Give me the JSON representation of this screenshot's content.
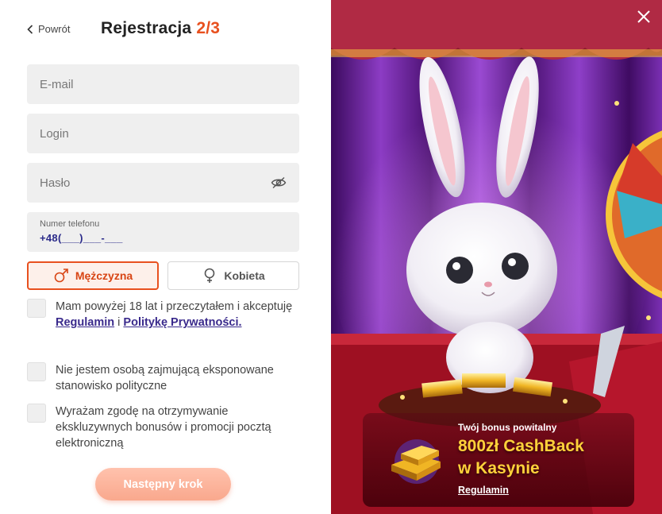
{
  "header": {
    "back_label": "Powrót",
    "title": "Rejestracja",
    "step": "2/3"
  },
  "form": {
    "email_placeholder": "E-mail",
    "login_placeholder": "Login",
    "password_placeholder": "Hasło",
    "phone_label": "Numer telefonu",
    "phone_value": "+48(___)___-___"
  },
  "gender": {
    "male_label": "Mężczyzna",
    "female_label": "Kobieta",
    "selected": "male"
  },
  "consents": {
    "age_text_1": "Mam powyżej 18 lat i przeczytałem i akceptuję",
    "age_link_terms": "Regulamin",
    "age_text_and": "i",
    "age_link_privacy": "Politykę Prywatności.",
    "political_text": "Nie jestem osobą zajmującą eksponowane stanowisko polityczne",
    "marketing_text": "Wyrażam zgodę na otrzymywanie ekskluzywnych bonusów i promocji pocztą elektroniczną"
  },
  "next_label": "Następny krok",
  "promo": {
    "subtitle": "Twój bonus powitalny",
    "title_line1": "800zł CashBack",
    "title_line2": "w Kasynie",
    "link": "Regulamin"
  },
  "colors": {
    "accent": "#e8501e",
    "link": "#3a2a8c",
    "promo_gold": "#ffd23a"
  },
  "icons": {
    "back": "chevron-left-icon",
    "eye": "eye-off-icon",
    "male": "male-symbol-icon",
    "female": "female-symbol-icon",
    "close": "close-icon"
  }
}
